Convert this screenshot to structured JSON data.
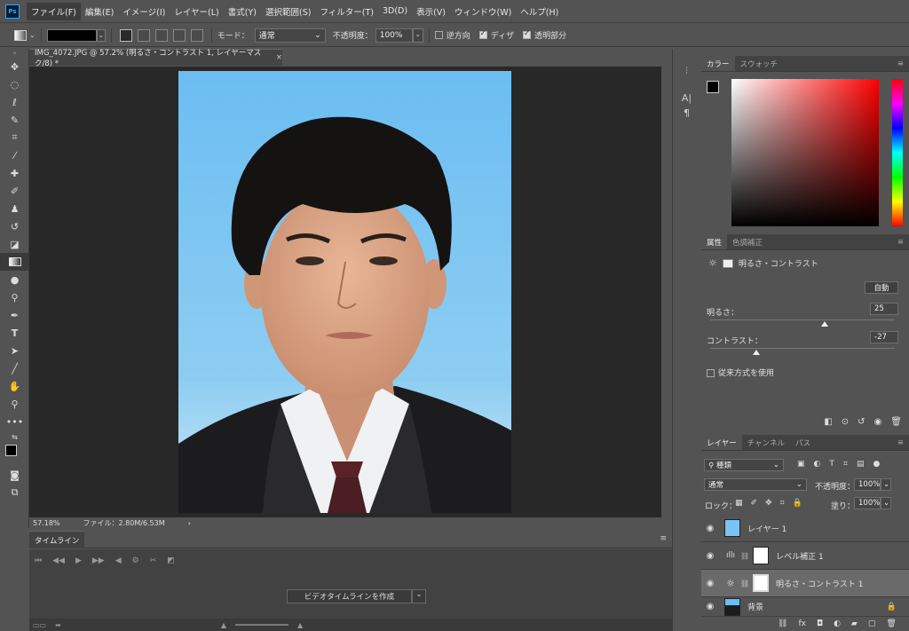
{
  "menubar": {
    "logo": "Ps",
    "items": [
      "ファイル(F)",
      "編集(E)",
      "イメージ(I)",
      "レイヤー(L)",
      "書式(Y)",
      "選択範囲(S)",
      "フィルター(T)",
      "3D(D)",
      "表示(V)",
      "ウィンドウ(W)",
      "ヘルプ(H)"
    ]
  },
  "options": {
    "mode_label": "モード：",
    "mode_value": "通常",
    "opacity_label": "不透明度：",
    "opacity_value": "100%",
    "reverse_label": "逆方向",
    "dither_label": "ディザ",
    "transparency_label": "透明部分",
    "reverse_checked": false,
    "dither_checked": true,
    "transparency_checked": true,
    "fg_color": "#000000"
  },
  "document": {
    "tab_title": "IMG_4072.JPG @ 57.2% (明るさ・コントラスト 1, レイヤーマスク/8) *",
    "close": "×",
    "zoom": "57.18%",
    "file_info": "ファイル：2.80M/6.53M",
    "arrow": "›"
  },
  "timeline": {
    "tab": "タイムライン",
    "create_button": "ビデオタイムラインを作成"
  },
  "color_panel": {
    "tabs": [
      "カラー",
      "スウォッチ"
    ]
  },
  "properties": {
    "tabs": [
      "属性",
      "色調補正"
    ],
    "title": "明るさ・コントラスト",
    "auto_button": "自動",
    "brightness_label": "明るさ：",
    "brightness_value": "25",
    "brightness_frac": 0.62,
    "contrast_label": "コントラスト：",
    "contrast_value": "-27",
    "contrast_frac": 0.25,
    "legacy_label": "従来方式を使用",
    "legacy_checked": false
  },
  "layers": {
    "tabs": [
      "レイヤー",
      "チャンネル",
      "パス"
    ],
    "filter_type": "種類",
    "blend_mode": "通常",
    "opacity_label": "不透明度：",
    "opacity_value": "100%",
    "lock_label": "ロック：",
    "fill_label": "塗り：",
    "fill_value": "100%",
    "items": [
      {
        "name": "レイヤー 1"
      },
      {
        "name": "レベル補正 1"
      },
      {
        "name": "明るさ・コントラスト 1"
      },
      {
        "name": "背景"
      }
    ]
  }
}
